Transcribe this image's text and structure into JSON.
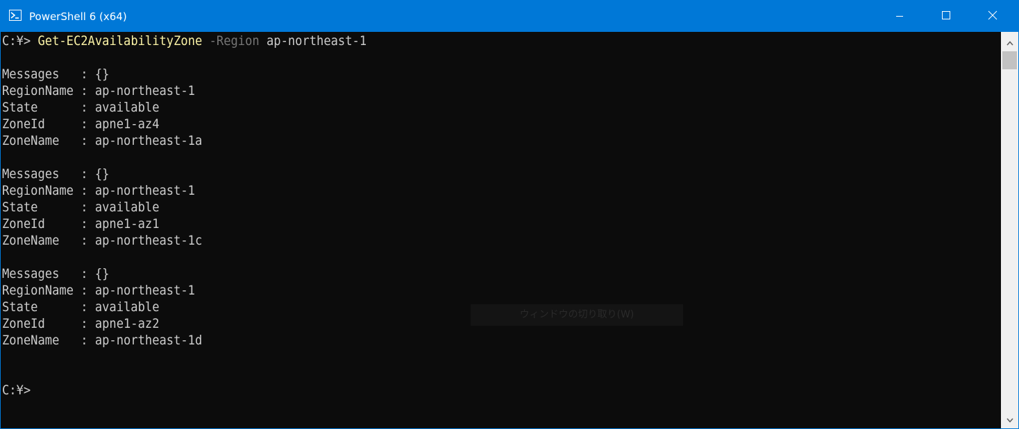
{
  "window": {
    "title": "PowerShell 6 (x64)",
    "accent_color": "#0078d7",
    "background_color": "#0c0c0c"
  },
  "console": {
    "prompt": "C:¥>",
    "command": {
      "cmdlet": "Get-EC2AvailabilityZone",
      "parameter": "-Region",
      "argument": "ap-northeast-1"
    },
    "results": [
      {
        "messages": "Messages   : {}",
        "region_name": "RegionName : ap-northeast-1",
        "state": "State      : available",
        "zone_id": "ZoneId     : apne1-az4",
        "zone_name": "ZoneName   : ap-northeast-1a"
      },
      {
        "messages": "Messages   : {}",
        "region_name": "RegionName : ap-northeast-1",
        "state": "State      : available",
        "zone_id": "ZoneId     : apne1-az1",
        "zone_name": "ZoneName   : ap-northeast-1c"
      },
      {
        "messages": "Messages   : {}",
        "region_name": "RegionName : ap-northeast-1",
        "state": "State      : available",
        "zone_id": "ZoneId     : apne1-az2",
        "zone_name": "ZoneName   : ap-northeast-1d"
      }
    ],
    "final_prompt": "C:¥>",
    "colors": {
      "text": "#cccccc",
      "cmdlet": "#f9f1a5",
      "parameter": "#767676"
    }
  },
  "overlay": {
    "faint_text": "ウィンドウの切り取り(W)"
  },
  "icons": {
    "app": "powershell-icon",
    "minimize": "minimize-icon",
    "maximize": "maximize-icon",
    "close": "close-icon",
    "scroll_up": "chevron-up-icon",
    "scroll_down": "chevron-down-icon"
  }
}
